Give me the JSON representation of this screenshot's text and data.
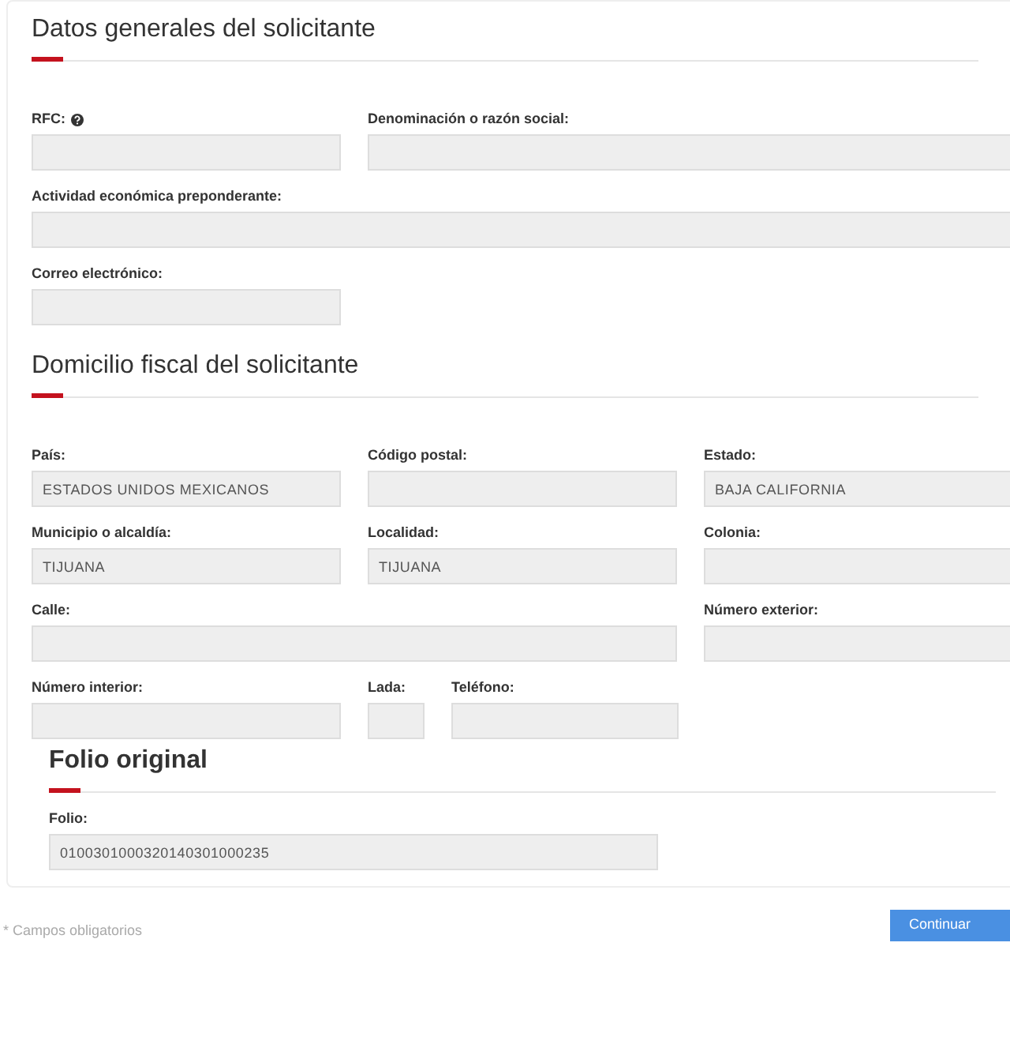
{
  "sections": [
    {
      "title": "Datos generales del solicitante",
      "fields": [
        {
          "label": "RFC:"
        },
        {
          "label": "Denominación o razón social:"
        },
        {
          "label": "Actividad económica preponderante:"
        },
        {
          "label": "Correo electrónico:"
        }
      ]
    },
    {
      "title": "Domicilio fiscal del solicitante",
      "fields": [
        {
          "label": "País:",
          "value": "ESTADOS UNIDOS MEXICANOS"
        },
        {
          "label": "Código postal:"
        },
        {
          "label": "Estado:",
          "value": "BAJA CALIFORNIA"
        },
        {
          "label": "Municipio o alcaldía:",
          "value": "TIJUANA"
        },
        {
          "label": "Localidad:",
          "value": "TIJUANA"
        },
        {
          "label": "Colonia:"
        },
        {
          "label": "Calle:"
        },
        {
          "label": "Número exterior:"
        },
        {
          "label": "Número interior:"
        },
        {
          "label": "Lada:"
        },
        {
          "label": "Teléfono:"
        }
      ]
    },
    {
      "title": "Folio original",
      "fields": [
        {
          "label": "Folio:",
          "value": "0100301000320140301000235"
        }
      ]
    }
  ],
  "footnote": "* Campos obligatorios",
  "button": "Continuar"
}
